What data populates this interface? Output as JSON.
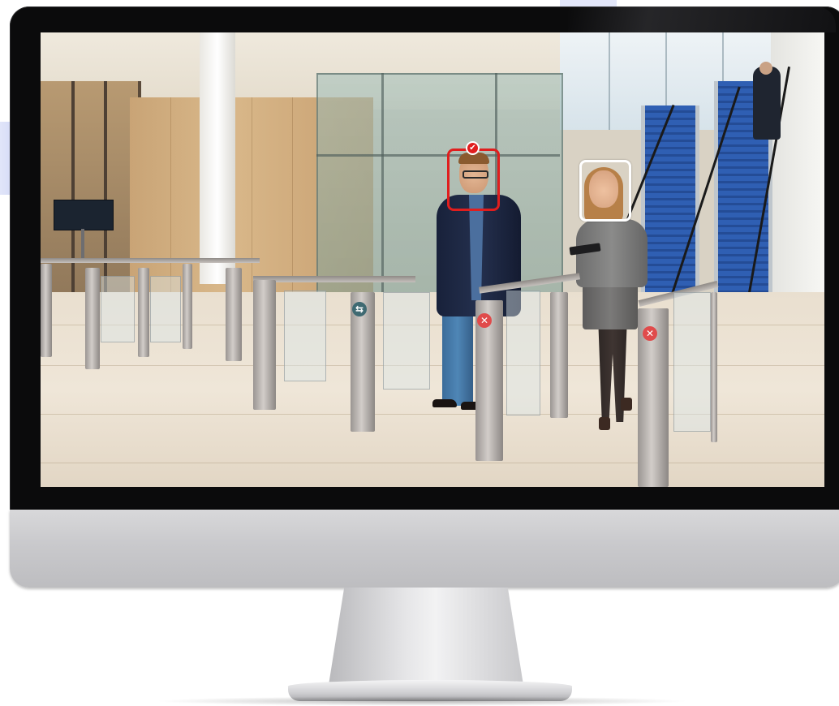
{
  "monitor": {
    "bezel_color": "#0b0b0c",
    "body_color": "#c9c9cc"
  },
  "scene": {
    "icons": {
      "verified_badge": "check-icon",
      "gate_denied": "x-icon",
      "gate_allowed": "arrow-icon"
    },
    "face_boxes": [
      {
        "status": "verified",
        "color": "#e01e1e"
      },
      {
        "status": "detected",
        "color": "#ffffff"
      }
    ],
    "gate_signs": {
      "denied_symbol": "✕",
      "allowed_symbol": "⇆",
      "denied_color": "#e04b4b",
      "allowed_color": "#3f6a72"
    },
    "badge_symbol": "✔"
  }
}
